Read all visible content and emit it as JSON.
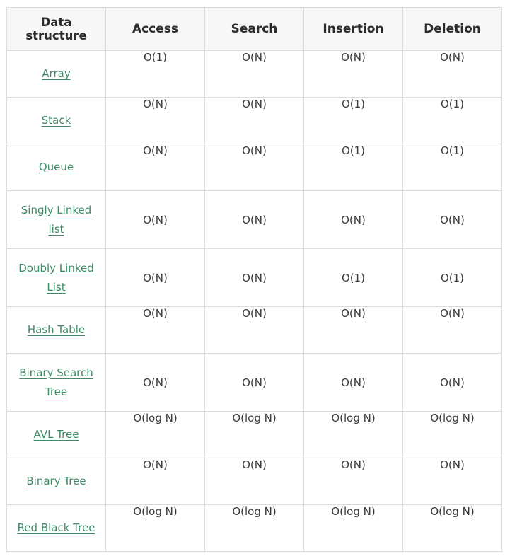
{
  "headers": [
    "Data structure",
    "Access",
    "Search",
    "Insertion",
    "Deletion"
  ],
  "colors": {
    "link": "#3f8a67",
    "header_bg": "#f7f7f7",
    "border": "#dcdcdc"
  },
  "rows": [
    {
      "name_line1": "Array",
      "name_line2": "",
      "access": "O(1)",
      "search": "O(N)",
      "insertion": "O(N)",
      "deletion": "O(N)"
    },
    {
      "name_line1": "Stack",
      "name_line2": "",
      "access": "O(N)",
      "search": "O(N)",
      "insertion": "O(1)",
      "deletion": "O(1)"
    },
    {
      "name_line1": "Queue",
      "name_line2": "",
      "access": "O(N)",
      "search": "O(N)",
      "insertion": "O(1)",
      "deletion": "O(1)"
    },
    {
      "name_line1": "Singly Linked",
      "name_line2": "list",
      "access": "O(N)",
      "search": "O(N)",
      "insertion": "O(N)",
      "deletion": "O(N)"
    },
    {
      "name_line1": "Doubly Linked",
      "name_line2": "List",
      "access": "O(N)",
      "search": "O(N)",
      "insertion": "O(1)",
      "deletion": "O(1)"
    },
    {
      "name_line1": "Hash Table",
      "name_line2": "",
      "access": "O(N)",
      "search": "O(N)",
      "insertion": "O(N)",
      "deletion": "O(N)"
    },
    {
      "name_line1": "Binary Search",
      "name_line2": "Tree",
      "access": "O(N)",
      "search": "O(N)",
      "insertion": "O(N)",
      "deletion": "O(N)"
    },
    {
      "name_line1": "AVL Tree",
      "name_line2": "",
      "access": "O(log N)",
      "search": "O(log N)",
      "insertion": "O(log N)",
      "deletion": "O(log N)"
    },
    {
      "name_line1": "Binary Tree",
      "name_line2": "",
      "access": "O(N)",
      "search": "O(N)",
      "insertion": "O(N)",
      "deletion": "O(N)"
    },
    {
      "name_line1": "Red Black Tree",
      "name_line2": "",
      "access": "O(log N)",
      "search": "O(log N)",
      "insertion": "O(log N)",
      "deletion": "O(log N)"
    }
  ]
}
